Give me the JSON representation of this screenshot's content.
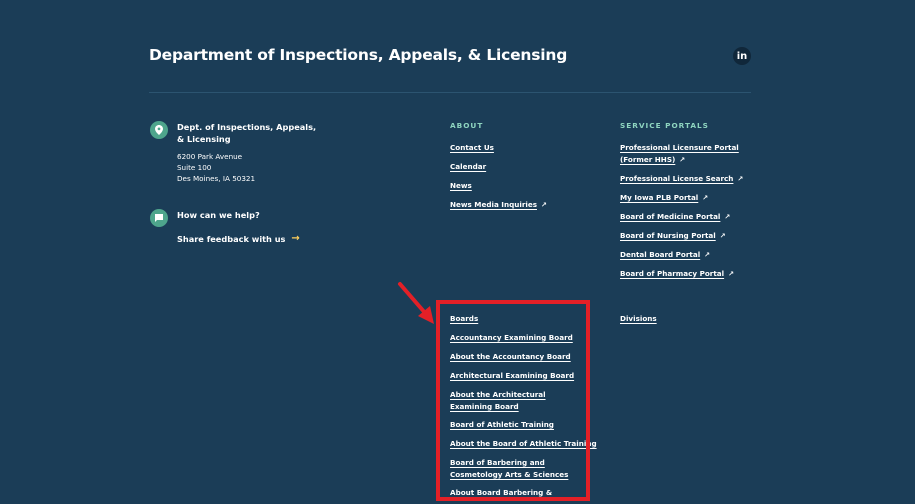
{
  "header": {
    "title": "Department of Inspections, Appeals, & Licensing",
    "linkedin_label": "in"
  },
  "contact": {
    "org_name": "Dept. of Inspections, Appeals, & Licensing",
    "address_line1": "6200 Park Avenue",
    "address_line2": "Suite 100",
    "address_line3": "Des Moines, IA 50321",
    "help_heading": "How can we help?",
    "feedback_label": "Share feedback with us",
    "feedback_arrow": "→"
  },
  "about": {
    "heading": "ABOUT",
    "links": [
      "Contact Us",
      "Calendar",
      "News",
      "News Media Inquiries"
    ]
  },
  "portals": {
    "heading": "SERVICE PORTALS",
    "links": [
      "Professional Licensure Portal (Former HHS)",
      "Professional License Search",
      "My Iowa PLB Portal",
      "Board of Medicine Portal",
      "Board of Nursing Portal",
      "Dental Board Portal",
      "Board of Pharmacy Portal"
    ]
  },
  "boards": {
    "links": [
      "Boards",
      "Accountancy Examining Board",
      "About the Accountancy Board",
      "Architectural Examining Board",
      "About the Architectural Examining Board",
      "Board of Athletic Training",
      "About the Board of Athletic Training",
      "Board of Barbering and Cosmetology Arts & Sciences",
      "About Board Barbering &"
    ]
  },
  "divisions": {
    "label": "Divisions"
  },
  "icons": {
    "external": "external-link-icon"
  },
  "colors": {
    "background": "#1b3d57",
    "accent": "#8fd5c0",
    "pin": "#4ea58c",
    "highlight": "#e32027",
    "arrow": "#ffcf5c"
  }
}
